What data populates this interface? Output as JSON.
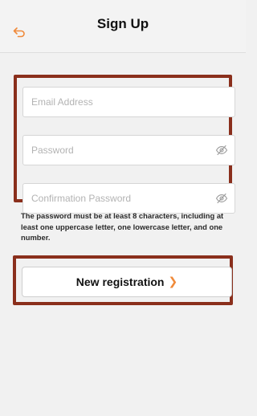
{
  "header": {
    "title": "Sign Up"
  },
  "form": {
    "email_placeholder": "Email Address",
    "password_placeholder": "Password",
    "confirm_placeholder": "Confirmation Password"
  },
  "hint": {
    "text": "The password must be at least 8 characters, including at least one uppercase letter, one lowercase letter, and one number."
  },
  "actions": {
    "register_label": "New registration",
    "register_chevron": "❯"
  },
  "colors": {
    "accent": "#f08a3a",
    "annotation_border": "#8a2f1c"
  },
  "icons": {
    "back": "back-arrow-icon",
    "toggle_visibility": "eye-off-icon"
  }
}
